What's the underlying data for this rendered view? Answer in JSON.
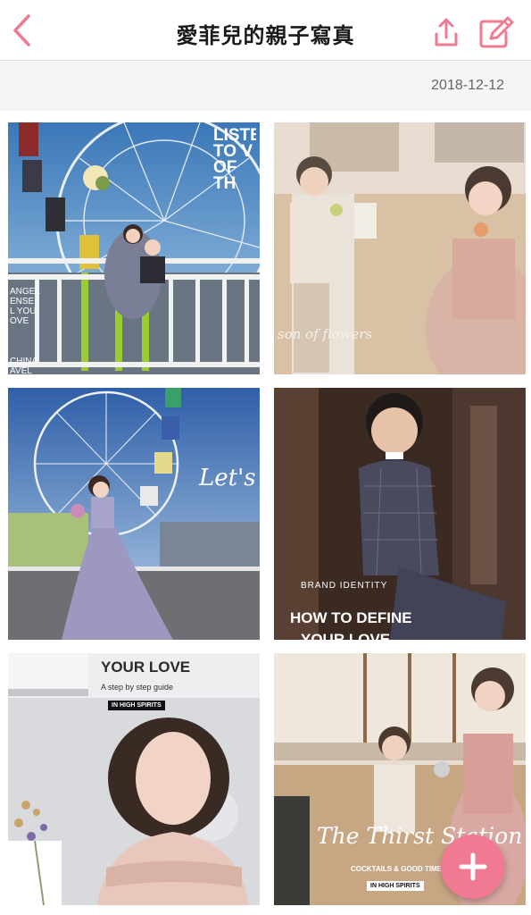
{
  "header": {
    "title": "愛菲兒的親子寫真",
    "back_icon": "chevron-left-icon",
    "share_icon": "share-upload-icon",
    "edit_icon": "edit-pencil-icon",
    "accent_color": "#f07a91"
  },
  "album": {
    "date": "2018-12-12"
  },
  "photos": [
    {
      "overlay_lines": [
        "LISTEN",
        "TO V",
        "OF TH"
      ],
      "side_lines": [
        "ANGEL",
        "ENSE",
        "L YOU",
        "OVE",
        "CHINA",
        "AVEL"
      ]
    },
    {
      "caption": "son of flowers"
    },
    {
      "script_title": "Let's"
    },
    {
      "kicker": "BRAND IDENTITY",
      "headline": "HOW TO DEFINE",
      "headline2": "YOUR LOVE"
    },
    {
      "headline": "YOUR LOVE",
      "sub": "A step by step guide",
      "badge": "IN HIGH SPIRITS"
    },
    {
      "script_title": "The Thirst Station",
      "sub": "COCKTAILS & GOOD TIMES",
      "badge": "IN HIGH SPIRITS"
    }
  ],
  "fab": {
    "icon": "plus-icon"
  }
}
